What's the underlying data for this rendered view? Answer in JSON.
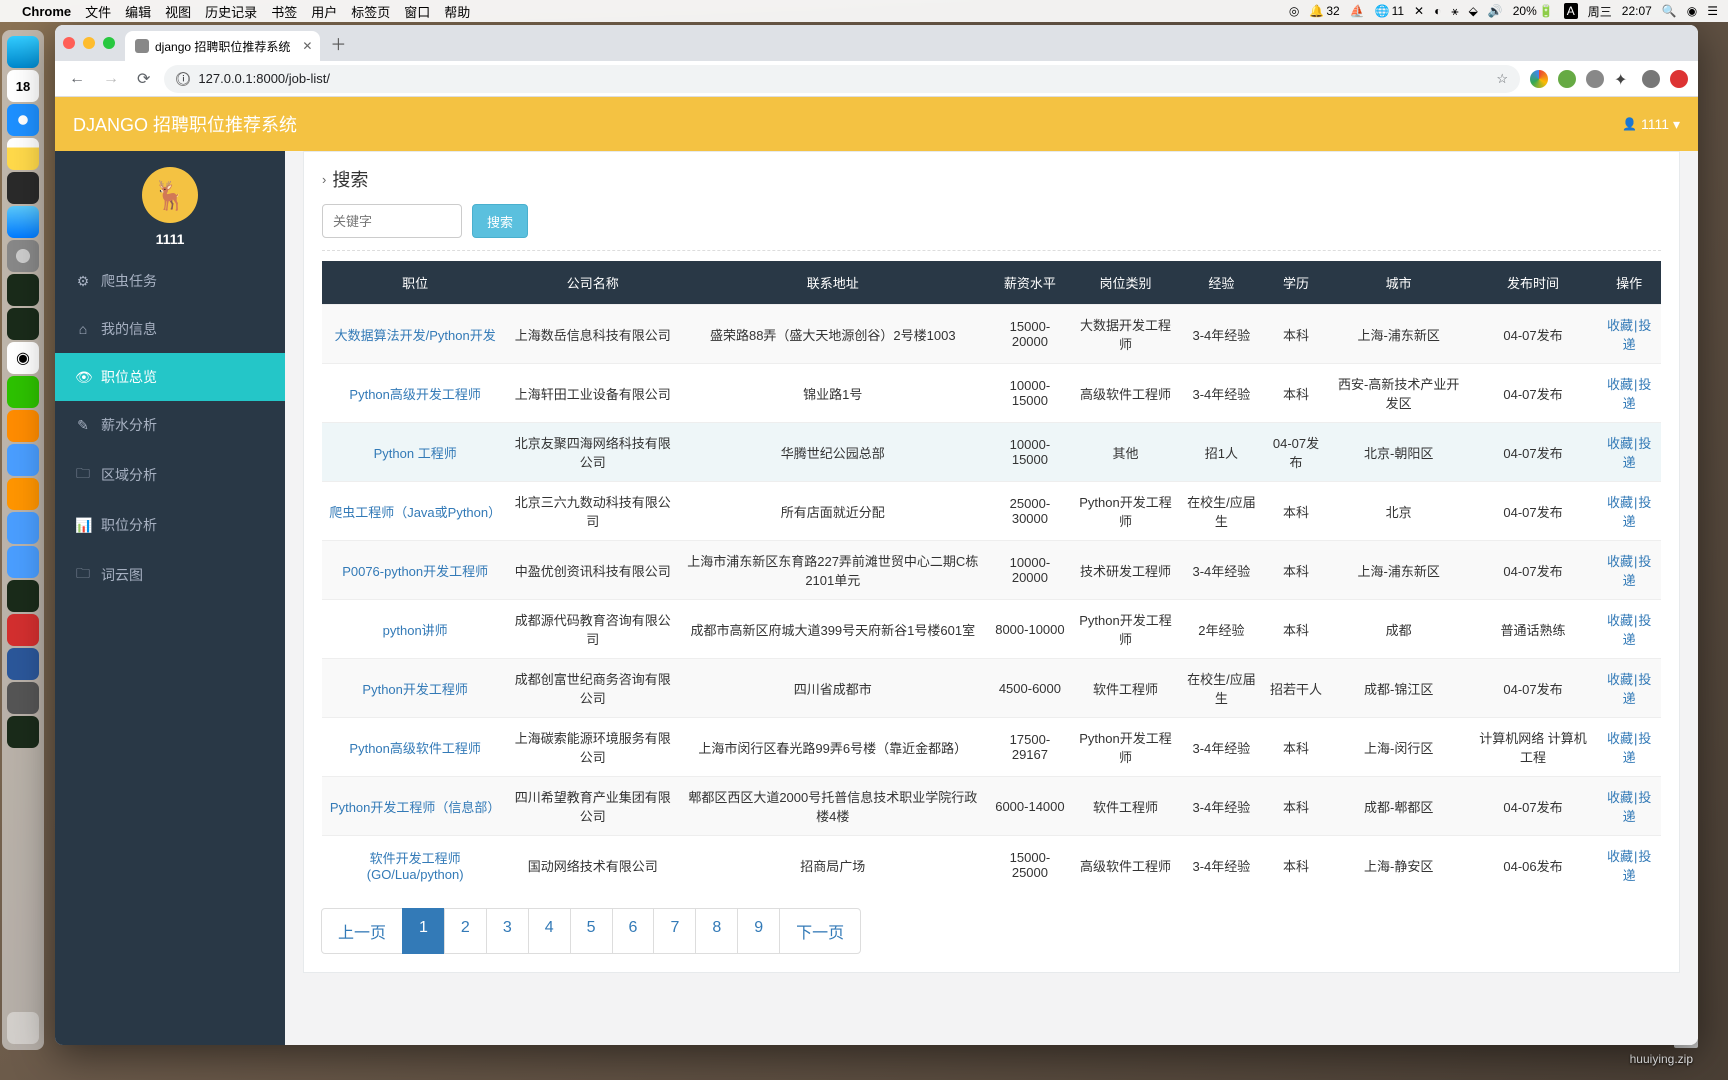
{
  "menubar": {
    "app": "Chrome",
    "items": [
      "文件",
      "编辑",
      "视图",
      "历史记录",
      "书签",
      "用户",
      "标签页",
      "窗口",
      "帮助"
    ],
    "right": {
      "n1": "32",
      "n2": "11",
      "battery": "20%",
      "day": "周三",
      "time": "22:07"
    }
  },
  "browser": {
    "tab_title": "django 招聘职位推荐系统",
    "url": "127.0.0.1:8000/job-list/"
  },
  "topbar": {
    "title": "DJANGO 招聘职位推荐系统",
    "user": "1111 ▾"
  },
  "sidebar": {
    "name": "1111",
    "items": [
      {
        "icon": "⚙",
        "label": "爬虫任务"
      },
      {
        "icon": "⌂",
        "label": "我的信息"
      },
      {
        "icon": "👁",
        "label": "职位总览"
      },
      {
        "icon": "✎",
        "label": "薪水分析"
      },
      {
        "icon": "🗀",
        "label": "区域分析"
      },
      {
        "icon": "📊",
        "label": "职位分析"
      },
      {
        "icon": "🗀",
        "label": "词云图"
      }
    ],
    "active_index": 2
  },
  "search": {
    "heading": "搜索",
    "placeholder": "关键字",
    "button": "搜索"
  },
  "columns": [
    "职位",
    "公司名称",
    "联系地址",
    "薪资水平",
    "岗位类别",
    "经验",
    "学历",
    "城市",
    "发布时间",
    "操作"
  ],
  "ops": {
    "fav": "收藏",
    "apply": "投递"
  },
  "rows": [
    {
      "title": "大数据算法开发/Python开发",
      "company": "上海数岳信息科技有限公司",
      "addr": "盛荣路88弄（盛大天地源创谷）2号楼1003",
      "salary": "15000-20000",
      "cat": "大数据开发工程师",
      "exp": "3-4年经验",
      "edu": "本科",
      "city": "上海-浦东新区",
      "pub": "04-07发布"
    },
    {
      "title": "Python高级开发工程师",
      "company": "上海轩田工业设备有限公司",
      "addr": "锦业路1号",
      "salary": "10000-15000",
      "cat": "高级软件工程师",
      "exp": "3-4年经验",
      "edu": "本科",
      "city": "西安-高新技术产业开发区",
      "pub": "04-07发布"
    },
    {
      "title": "Python 工程师",
      "company": "北京友聚四海网络科技有限公司",
      "addr": "华腾世纪公园总部",
      "salary": "10000-15000",
      "cat": "其他",
      "exp": "招1人",
      "edu": "04-07发布",
      "city": "北京-朝阳区",
      "pub": "04-07发布"
    },
    {
      "title": "爬虫工程师（Java或Python）",
      "company": "北京三六九数动科技有限公司",
      "addr": "所有店面就近分配",
      "salary": "25000-30000",
      "cat": "Python开发工程师",
      "exp": "在校生/应届生",
      "edu": "本科",
      "city": "北京",
      "pub": "04-07发布"
    },
    {
      "title": "P0076-python开发工程师",
      "company": "中盈优创资讯科技有限公司",
      "addr": "上海市浦东新区东育路227弄前滩世贸中心二期C栋2101单元",
      "salary": "10000-20000",
      "cat": "技术研发工程师",
      "exp": "3-4年经验",
      "edu": "本科",
      "city": "上海-浦东新区",
      "pub": "04-07发布"
    },
    {
      "title": "python讲师",
      "company": "成都源代码教育咨询有限公司",
      "addr": "成都市高新区府城大道399号天府新谷1号楼601室",
      "salary": "8000-10000",
      "cat": "Python开发工程师",
      "exp": "2年经验",
      "edu": "本科",
      "city": "成都",
      "pub": "普通话熟练"
    },
    {
      "title": "Python开发工程师",
      "company": "成都创富世纪商务咨询有限公司",
      "addr": "四川省成都市",
      "salary": "4500-6000",
      "cat": "软件工程师",
      "exp": "在校生/应届生",
      "edu": "招若干人",
      "city": "成都-锦江区",
      "pub": "04-07发布"
    },
    {
      "title": "Python高级软件工程师",
      "company": "上海碳索能源环境服务有限公司",
      "addr": "上海市闵行区春光路99弄6号楼（靠近金都路）",
      "salary": "17500-29167",
      "cat": "Python开发工程师",
      "exp": "3-4年经验",
      "edu": "本科",
      "city": "上海-闵行区",
      "pub": "计算机网络 计算机工程"
    },
    {
      "title": "Python开发工程师（信息部）",
      "company": "四川希望教育产业集团有限公司",
      "addr": "郫都区西区大道2000号托普信息技术职业学院行政楼4楼",
      "salary": "6000-14000",
      "cat": "软件工程师",
      "exp": "3-4年经验",
      "edu": "本科",
      "city": "成都-郫都区",
      "pub": "04-07发布"
    },
    {
      "title": "软件开发工程师(GO/Lua/python)",
      "company": "国动网络技术有限公司",
      "addr": "招商局广场",
      "salary": "15000-25000",
      "cat": "高级软件工程师",
      "exp": "3-4年经验",
      "edu": "本科",
      "city": "上海-静安区",
      "pub": "04-06发布"
    }
  ],
  "pagination": {
    "prev": "上一页",
    "next": "下一页",
    "pages": [
      "1",
      "2",
      "3",
      "4",
      "5",
      "6",
      "7",
      "8",
      "9"
    ],
    "active": 0
  },
  "desktop": {
    "zip": "ZIP",
    "filename": "huuiying.zip"
  }
}
